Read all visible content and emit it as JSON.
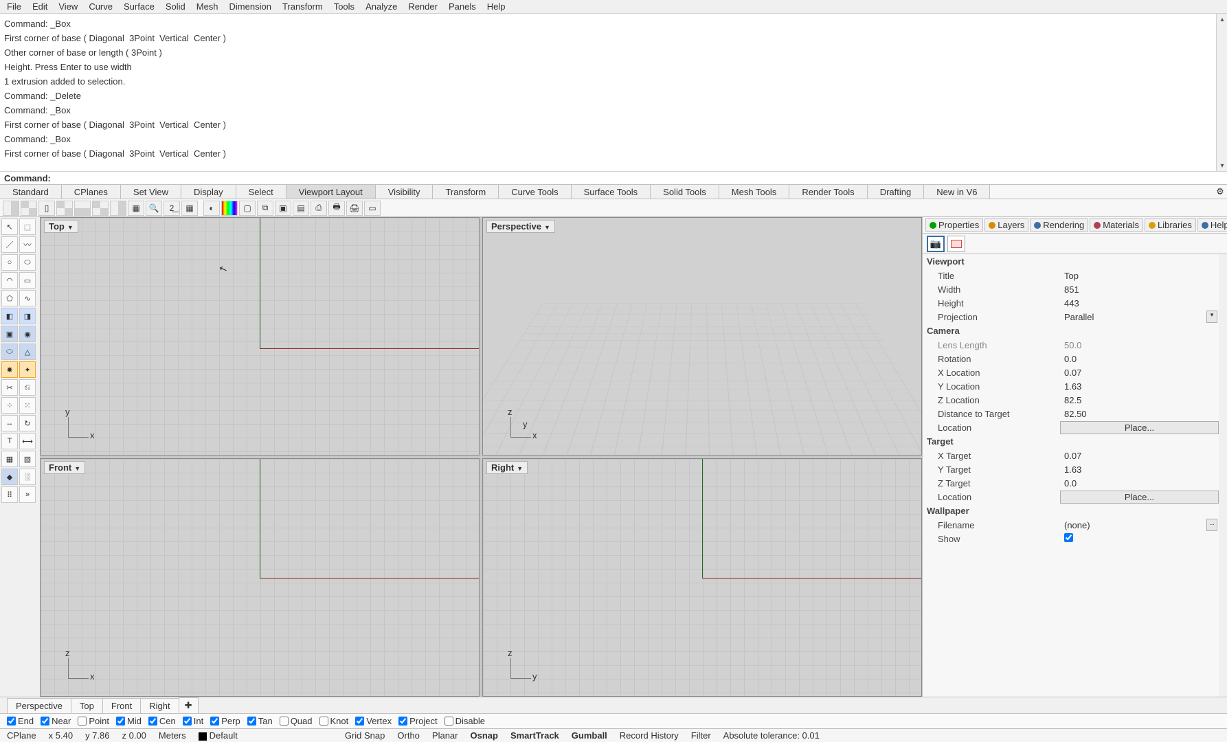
{
  "menubar": [
    "File",
    "Edit",
    "View",
    "Curve",
    "Surface",
    "Solid",
    "Mesh",
    "Dimension",
    "Transform",
    "Tools",
    "Analyze",
    "Render",
    "Panels",
    "Help"
  ],
  "cmd_history": [
    "Command: _Box",
    "First corner of base ( Diagonal  3Point  Vertical  Center )",
    "Other corner of base or length ( 3Point )",
    "Height. Press Enter to use width",
    "1 extrusion added to selection.",
    "Command: _Delete",
    "Command: _Box",
    "First corner of base ( Diagonal  3Point  Vertical  Center )",
    "Command: _Box",
    "First corner of base ( Diagonal  3Point  Vertical  Center )"
  ],
  "cmd_prompt": "Command:",
  "ribbon_tabs": [
    "Standard",
    "CPlanes",
    "Set View",
    "Display",
    "Select",
    "Viewport Layout",
    "Visibility",
    "Transform",
    "Curve Tools",
    "Surface Tools",
    "Solid Tools",
    "Mesh Tools",
    "Render Tools",
    "Drafting",
    "New in V6"
  ],
  "ribbon_active": "Viewport Layout",
  "viewports": {
    "tl": "Top",
    "tr": "Perspective",
    "bl": "Front",
    "br": "Right"
  },
  "vptabs": [
    "Perspective",
    "Top",
    "Front",
    "Right"
  ],
  "panel_tabs": [
    {
      "label": "Properties",
      "color": "#00a000"
    },
    {
      "label": "Layers",
      "color": "#d88b00"
    },
    {
      "label": "Rendering",
      "color": "#3a6ea5"
    },
    {
      "label": "Materials",
      "color": "#b04050"
    },
    {
      "label": "Libraries",
      "color": "#d8a000"
    },
    {
      "label": "Help",
      "color": "#3a6ea5"
    }
  ],
  "props": {
    "viewport_h": "Viewport",
    "title_k": "Title",
    "title_v": "Top",
    "width_k": "Width",
    "width_v": "851",
    "height_k": "Height",
    "height_v": "443",
    "proj_k": "Projection",
    "proj_v": "Parallel",
    "camera_h": "Camera",
    "lens_k": "Lens Length",
    "lens_v": "50.0",
    "rot_k": "Rotation",
    "rot_v": "0.0",
    "xloc_k": "X Location",
    "xloc_v": "0.07",
    "yloc_k": "Y Location",
    "yloc_v": "1.63",
    "zloc_k": "Z Location",
    "zloc_v": "82.5",
    "dtt_k": "Distance to Target",
    "dtt_v": "82.50",
    "loc_k": "Location",
    "loc_btn": "Place...",
    "target_h": "Target",
    "xt_k": "X Target",
    "xt_v": "0.07",
    "yt_k": "Y Target",
    "yt_v": "1.63",
    "zt_k": "Z Target",
    "zt_v": "0.0",
    "tloc_k": "Location",
    "tloc_btn": "Place...",
    "wall_h": "Wallpaper",
    "fn_k": "Filename",
    "fn_v": "(none)",
    "show_k": "Show"
  },
  "osnap": {
    "end": {
      "l": "End",
      "c": true
    },
    "near": {
      "l": "Near",
      "c": true
    },
    "point": {
      "l": "Point",
      "c": false
    },
    "mid": {
      "l": "Mid",
      "c": true
    },
    "cen": {
      "l": "Cen",
      "c": true
    },
    "int": {
      "l": "Int",
      "c": true
    },
    "perp": {
      "l": "Perp",
      "c": true
    },
    "tan": {
      "l": "Tan",
      "c": true
    },
    "quad": {
      "l": "Quad",
      "c": false
    },
    "knot": {
      "l": "Knot",
      "c": false
    },
    "vertex": {
      "l": "Vertex",
      "c": true
    },
    "project": {
      "l": "Project",
      "c": true
    },
    "disable": {
      "l": "Disable",
      "c": false
    }
  },
  "status": {
    "cplane": "CPlane",
    "x": "x 5.40",
    "y": "y 7.86",
    "z": "z 0.00",
    "units": "Meters",
    "layer": "Default",
    "gridsnap": "Grid Snap",
    "ortho": "Ortho",
    "planar": "Planar",
    "osnap": "Osnap",
    "smart": "SmartTrack",
    "gumball": "Gumball",
    "rec": "Record History",
    "filter": "Filter",
    "tol": "Absolute tolerance: 0.01"
  },
  "triads": {
    "top": {
      "v": "y",
      "h": "x"
    },
    "persp": {
      "v": "z",
      "d": "y",
      "h": "x"
    },
    "front": {
      "v": "z",
      "h": "x"
    },
    "right": {
      "v": "z",
      "h": "y"
    }
  },
  "ellipsis": "..."
}
